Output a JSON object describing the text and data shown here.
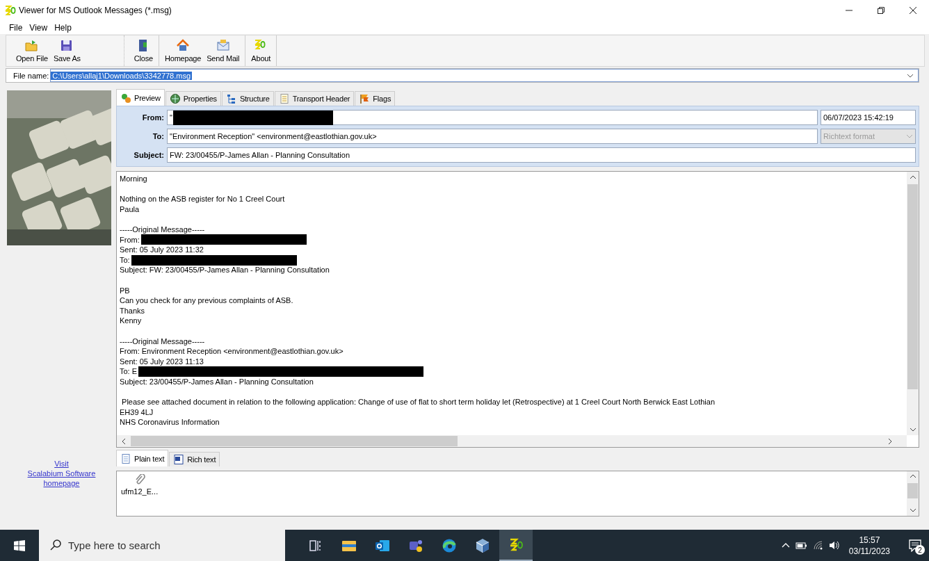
{
  "window": {
    "title": "Viewer for MS Outlook Messages (*.msg)"
  },
  "menu": [
    {
      "label": "File"
    },
    {
      "label": "View"
    },
    {
      "label": "Help"
    }
  ],
  "toolbar": {
    "groups": [
      [
        {
          "label": "Open File",
          "kind": "open"
        },
        {
          "label": "Save As",
          "kind": "save"
        }
      ],
      [
        {
          "label": "Close",
          "kind": "close"
        }
      ],
      [
        {
          "label": "Homepage",
          "kind": "home"
        },
        {
          "label": "Send Mail",
          "kind": "mail"
        }
      ],
      [
        {
          "label": "About",
          "kind": "about"
        }
      ]
    ]
  },
  "file_name": {
    "label": "File name:",
    "value": "C:\\Users\\allaj1\\Downloads\\3342778.msg",
    "highlighted": true
  },
  "sidebar": {
    "picture": {
      "kind": "picture"
    },
    "link": [
      "Visit",
      "Scalabium Software",
      "homepage"
    ]
  },
  "tabs": [
    {
      "label": "Preview",
      "kind": "preview",
      "selected": true
    },
    {
      "label": "Properties",
      "kind": "properties",
      "selected": false
    },
    {
      "label": "Structure",
      "kind": "structure",
      "selected": false
    },
    {
      "label": "Transport Header",
      "kind": "transport",
      "selected": false
    },
    {
      "label": "Flags",
      "kind": "flags",
      "selected": false
    }
  ],
  "header": {
    "from": {
      "label": "From:",
      "value": "\"",
      "redacted": true
    },
    "date": "06/07/2023 15:42:19",
    "to": {
      "label": "To:",
      "value": "\"Environment Reception\" <environment@eastlothian.gov.uk>"
    },
    "format": {
      "value": "Richtext format",
      "disabled": true
    },
    "subject": {
      "label": "Subject:",
      "value": "FW: 23/00455/P-James Allan  - Planning Consultation"
    }
  },
  "body": {
    "paragraphs": [
      [
        {
          "text": "Morning",
          "kind": "text"
        }
      ],
      [
        {
          "text": "Nothing on the ASB register for No 1 Creel Court",
          "kind": "text"
        },
        {
          "text": "Paula",
          "kind": "text"
        }
      ],
      [
        {
          "text": "-----Original Message-----",
          "kind": "text"
        },
        {
          "text": "From:",
          "kind": "redacted"
        },
        {
          "text": "Sent: 05 July 2023 11:32",
          "kind": "text"
        },
        {
          "text": "To:",
          "kind": "redacted"
        },
        {
          "text": "Subject: FW: 23/00455/P-James Allan - Planning Consultation",
          "kind": "text"
        }
      ],
      [
        {
          "text": "PB",
          "kind": "text"
        },
        {
          "text": "Can you check for any previous complaints of ASB.",
          "kind": "text"
        },
        {
          "text": "Thanks",
          "kind": "text"
        },
        {
          "text": "Kenny",
          "kind": "text"
        }
      ],
      [
        {
          "text": "-----Original Message-----",
          "kind": "text"
        },
        {
          "text": "From: Environment Reception <environment@eastlothian.gov.uk>",
          "kind": "text"
        },
        {
          "text": "Sent: 05 July 2023 11:13",
          "kind": "text"
        },
        {
          "text": "To: E",
          "kind": "redacted_wide"
        },
        {
          "text": "Subject: 23/00455/P-James Allan - Planning Consultation",
          "kind": "text"
        }
      ],
      [
        {
          "text": " Please see attached document in relation to the following application: Change of use of flat to short term holiday let (Retrospective) at 1 Creel Court North Berwick East Lothian",
          "kind": "text"
        },
        {
          "text": "EH39 4LJ",
          "kind": "text"
        },
        {
          "text": "NHS Coronavirus Information",
          "kind": "text"
        }
      ]
    ]
  },
  "body_tabs": [
    {
      "label": "Plain text",
      "kind": "plain",
      "selected": true
    },
    {
      "label": "Rich text",
      "kind": "rich",
      "selected": false
    }
  ],
  "attachments": [
    {
      "name": "ufm12_E..."
    }
  ],
  "taskbar": {
    "search": {
      "placeholder": "Type here to search"
    },
    "apps": [
      {
        "kind": "taskview",
        "selected": false
      },
      {
        "kind": "explorer",
        "selected": false
      },
      {
        "kind": "outlook",
        "selected": false
      },
      {
        "kind": "teams",
        "selected": false
      },
      {
        "kind": "edge",
        "selected": false
      },
      {
        "kind": "cube",
        "selected": false
      },
      {
        "kind": "viewer",
        "selected": true
      }
    ],
    "time": "15:57",
    "date": "03/11/2023",
    "notifications": "2"
  }
}
